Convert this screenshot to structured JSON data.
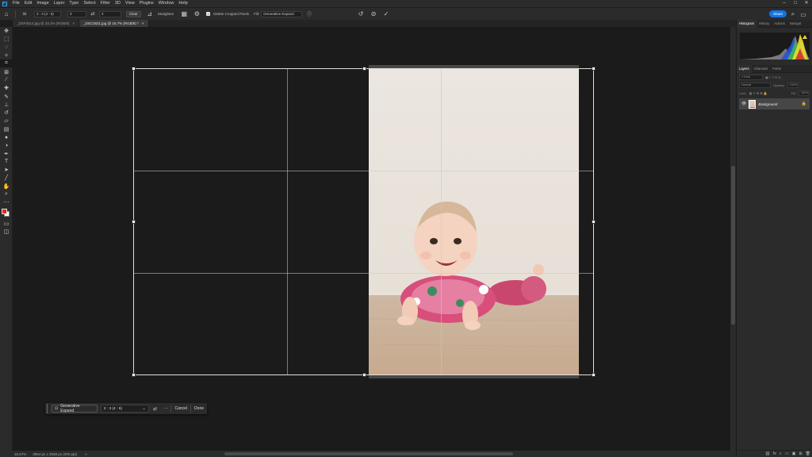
{
  "app": {
    "logo": "Ps",
    "menu": [
      "File",
      "Edit",
      "Image",
      "Layer",
      "Type",
      "Select",
      "Filter",
      "3D",
      "View",
      "Plugins",
      "Window",
      "Help"
    ],
    "window_controls": [
      "–",
      "□",
      "✕"
    ]
  },
  "options_bar": {
    "ratio_value": "2 : 3 (4 : 6)",
    "width_value": "3",
    "height_value": "2",
    "clear_label": "Clear",
    "straighten_label": "Straighten",
    "delete_cropped_label": "Delete Cropped Pixels",
    "fill_label": "Fill:",
    "fill_value": "Generative Expand",
    "share_label": "Share"
  },
  "tabs": [
    {
      "label": "_DSF0514.jpg @ 33.3% (RGB/8)",
      "close": "×",
      "active": false
    },
    {
      "label": "_DSC2621.jpg @ 16.7% (RGB/8) *",
      "close": "×",
      "active": true
    }
  ],
  "tools": [
    {
      "name": "move-tool",
      "glyph": "✥"
    },
    {
      "name": "marquee-tool",
      "glyph": "⬚"
    },
    {
      "name": "lasso-tool",
      "glyph": "◌"
    },
    {
      "name": "object-select-tool",
      "glyph": "✧"
    },
    {
      "name": "crop-tool",
      "glyph": "⌗"
    },
    {
      "name": "frame-tool",
      "glyph": "⊠"
    },
    {
      "name": "eyedropper-tool",
      "glyph": "⁄"
    },
    {
      "name": "healing-brush-tool",
      "glyph": "✚"
    },
    {
      "name": "brush-tool",
      "glyph": "✎"
    },
    {
      "name": "clone-stamp-tool",
      "glyph": "⊥"
    },
    {
      "name": "history-brush-tool",
      "glyph": "↺"
    },
    {
      "name": "eraser-tool",
      "glyph": "▱"
    },
    {
      "name": "gradient-tool",
      "glyph": "▤"
    },
    {
      "name": "blur-tool",
      "glyph": "●"
    },
    {
      "name": "dodge-tool",
      "glyph": "◑"
    },
    {
      "name": "pen-tool",
      "glyph": "✒"
    },
    {
      "name": "type-tool",
      "glyph": "T"
    },
    {
      "name": "path-select-tool",
      "glyph": "➤"
    },
    {
      "name": "line-tool",
      "glyph": "╱"
    },
    {
      "name": "hand-tool",
      "glyph": "✋"
    },
    {
      "name": "zoom-tool",
      "glyph": "⌕"
    },
    {
      "name": "more-tools",
      "glyph": "⋯"
    }
  ],
  "colors": {
    "foreground": "#e52b1a",
    "background": "#ffffff",
    "accent": "#1473e6"
  },
  "task_bar": {
    "generative_expand_label": "Generative Expand",
    "ratio_value": "2 : 3 (4 : 6)",
    "more_label": "···",
    "cancel_label": "Cancel",
    "done_label": "Done"
  },
  "status": {
    "zoom": "16.67%",
    "doc_info": "3964 px x 3938 px (300 ppi)",
    "arrow": ">"
  },
  "panels": {
    "top_tabs": [
      "Histogram",
      "History",
      "Actions",
      "Navigat"
    ],
    "layer_tabs": [
      "Layers",
      "Channels",
      "Paths"
    ],
    "kind_label": "Kind",
    "blend_mode": "Normal",
    "opacity_label": "Opacity:",
    "opacity_value": "100%",
    "lock_label": "Lock:",
    "fill_label": "Fill:",
    "fill_value": "100%",
    "layers": [
      {
        "name": "Background",
        "visible": true,
        "locked": true
      }
    ],
    "bottom_icons": [
      "fx",
      "◐",
      "▭",
      "▣",
      "⊞",
      "🗑"
    ]
  }
}
